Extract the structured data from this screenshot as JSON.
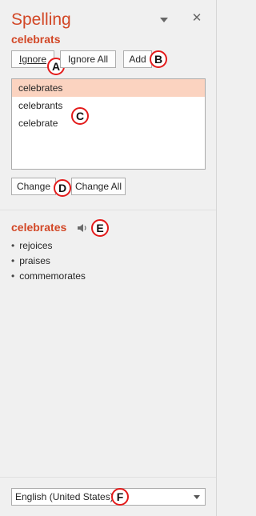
{
  "pane": {
    "title": "Spelling",
    "misspelled_word": "celebrats",
    "accent_color": "#d24726"
  },
  "buttons": {
    "ignore": "Ignore",
    "ignore_all": "Ignore All",
    "add": "Add",
    "change": "Change",
    "change_all": "Change All"
  },
  "suggestions": {
    "items": [
      "celebrates",
      "celebrants",
      "celebrate"
    ],
    "selected": "celebrates",
    "selected_color": "#fbd3c0"
  },
  "definition": {
    "word": "celebrates",
    "synonyms": [
      "rejoices",
      "praises",
      "commemorates"
    ]
  },
  "language": {
    "selected": "English (United States)"
  },
  "markers": [
    "A",
    "B",
    "C",
    "D",
    "E",
    "F"
  ],
  "icons": [
    "menu-dropdown-icon",
    "close-icon",
    "speaker-icon",
    "chevron-down-icon"
  ]
}
